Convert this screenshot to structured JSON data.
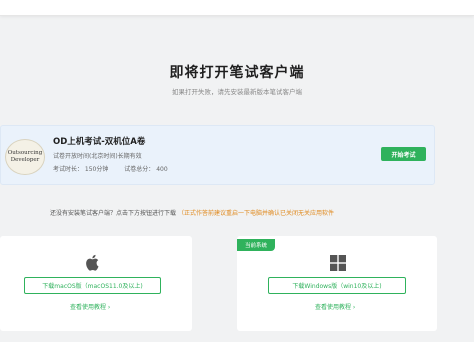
{
  "header": {
    "title": "即将打开笔试客户端",
    "subtitle": "如果打开失败，请先安装最新版本笔试客户端"
  },
  "exam": {
    "logo_line1": "Outsourcing",
    "logo_line2": "Developer",
    "name": "OD上机考试-双机位A卷",
    "open_time": "试卷开放时间(北京时间)长期有效",
    "duration": "考试时长： 150分钟",
    "total_score": "试卷总分： 400",
    "start_label": "开始考试"
  },
  "notice": {
    "text": "还没有安装笔试客户端？点击下方按钮进行下载",
    "warning": "（正式作答前建议重启一下电脑并确认已关闭无关应用软件"
  },
  "downloads": {
    "mac": {
      "icon": "apple-icon",
      "button_label": "下载macOS版（macOS11.0及以上)",
      "tutorial_label": "查看使用教程 ›"
    },
    "windows": {
      "badge": "当前系统",
      "icon": "windows-icon",
      "button_label": "下载Windows版（win10及以上)",
      "tutorial_label": "查看使用教程 ›"
    }
  },
  "colors": {
    "accent": "#2fb25c",
    "warning": "#e08a1e",
    "card_bg": "#eaf2fb",
    "page_bg": "#f1f2f3"
  }
}
